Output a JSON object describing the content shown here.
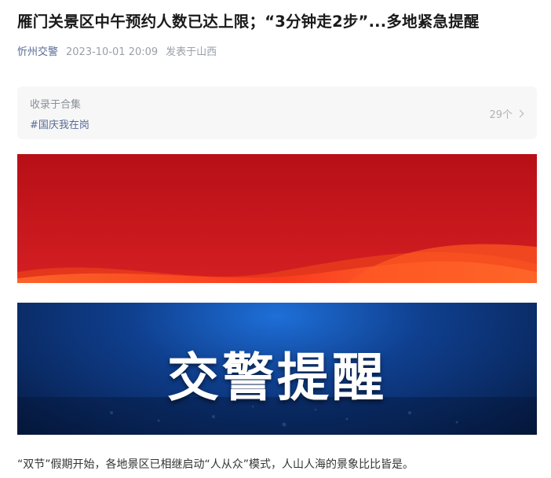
{
  "article": {
    "title": "雁门关景区中午预约人数已达上限；“3分钟走2步”...多地紧急提醒",
    "account": "忻州交警",
    "datetime": "2023-10-01 20:09",
    "location": "发表于山西"
  },
  "collection": {
    "label": "收录于合集",
    "tag": "#国庆我在岗",
    "count": "29个"
  },
  "banner_red": {
    "color": "#c0121b",
    "description_icon": "red-wave-banner"
  },
  "banner_blue": {
    "headline": "交警提醒",
    "color": "#0f3f8e"
  },
  "body": {
    "paragraph": "“双节”假期开始，各地景区已相继启动“人从众”模式，人山人海的景象比比皆是。"
  }
}
